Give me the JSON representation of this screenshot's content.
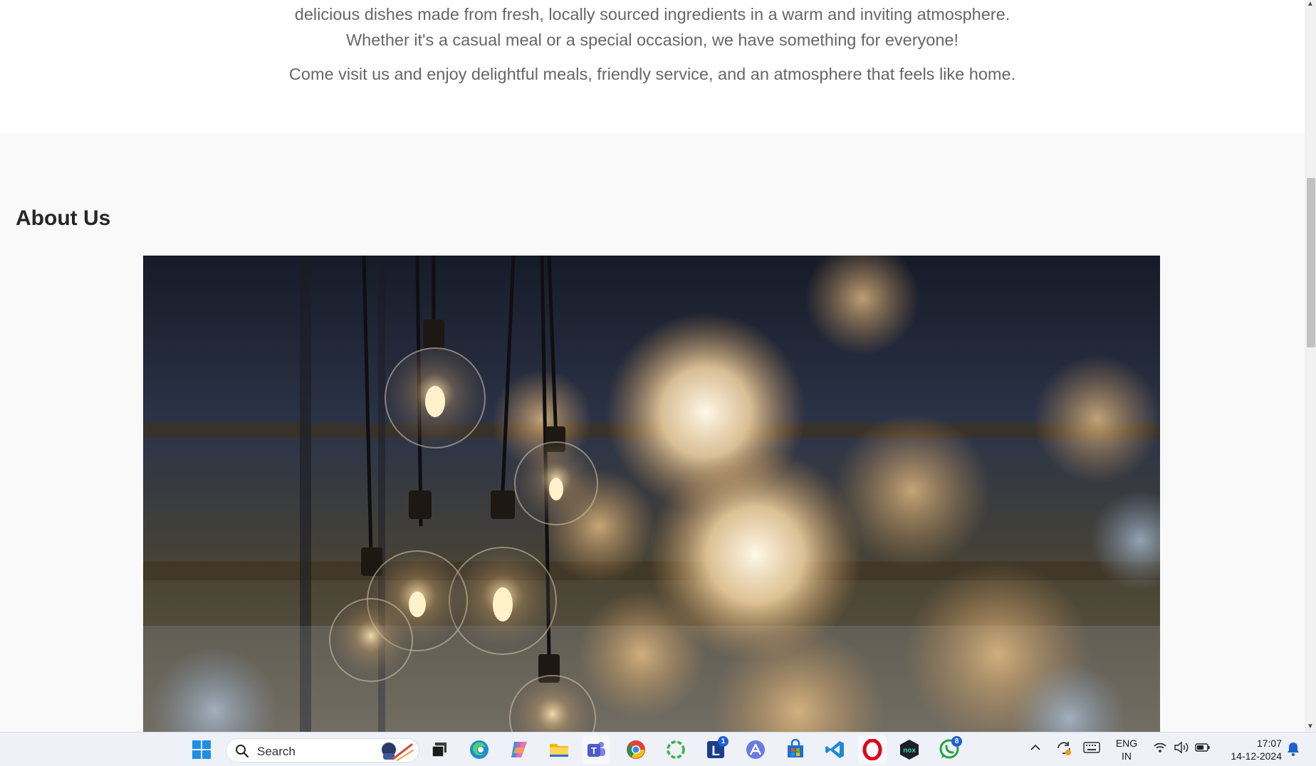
{
  "intro": {
    "line1": "delicious dishes made from fresh, locally sourced ingredients in a warm and inviting atmosphere.",
    "line2": "Whether it's a casual meal or a special occasion, we have something for everyone!",
    "paragraph2": "Come visit us and enjoy delightful meals, friendly service, and an atmosphere that feels like home."
  },
  "about": {
    "heading": "About Us",
    "image_description": "hanging-edison-bulbs-photo"
  },
  "taskbar": {
    "search_label": "Search",
    "apps": [
      {
        "name": "start",
        "icon": "windows-logo-icon"
      },
      {
        "name": "task-view",
        "icon": "task-view-icon"
      },
      {
        "name": "edge",
        "icon": "edge-icon"
      },
      {
        "name": "copilot",
        "icon": "copilot-icon"
      },
      {
        "name": "file-explorer",
        "icon": "folder-icon"
      },
      {
        "name": "teams",
        "icon": "teams-icon"
      },
      {
        "name": "chrome",
        "icon": "chrome-icon"
      },
      {
        "name": "ring-app",
        "icon": "green-ring-icon"
      },
      {
        "name": "l-app",
        "icon": "l-app-icon",
        "badge": "1"
      },
      {
        "name": "arc-app",
        "icon": "triangle-app-icon"
      },
      {
        "name": "store",
        "icon": "store-icon"
      },
      {
        "name": "vscode",
        "icon": "vscode-icon"
      },
      {
        "name": "opera",
        "icon": "opera-icon"
      },
      {
        "name": "nox",
        "icon": "nox-icon"
      },
      {
        "name": "whatsapp",
        "icon": "whatsapp-icon",
        "badge": "8"
      }
    ],
    "tray": {
      "language_line1": "ENG",
      "language_line2": "IN",
      "time": "17:07",
      "date": "14-12-2024"
    }
  },
  "colors": {
    "body_text": "#666666",
    "heading": "#262626",
    "section_bg": "#f9f9f9",
    "taskbar_bg": "#eef1f8"
  }
}
